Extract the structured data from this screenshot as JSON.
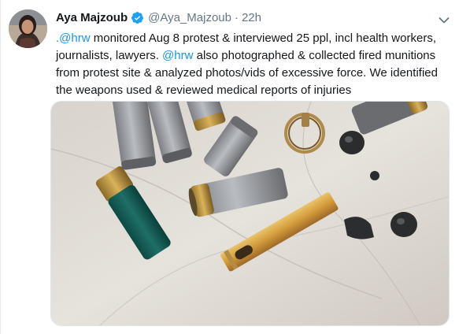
{
  "tweet": {
    "author_name": "Aya Majzoub",
    "handle": "@Aya_Majzoub",
    "separator": "·",
    "time": "22h",
    "text_lines": [
      {
        "mention": ".@hrw",
        "rest": " monitored Aug 8 protest & interviewed 25 ppl, incl health workers,"
      },
      {
        "before": "journalists, lawyers. ",
        "mention": "@hrw",
        "after": " also photographed & collected fired munitions"
      },
      {
        "text": "from protest site & analyzed photos/vids of excessive force. We identified"
      },
      {
        "text": "the weapons used & reviewed medical reports of injuries"
      }
    ]
  },
  "icons": {
    "verified": "verified-badge-icon",
    "caret": "chevron-down-icon"
  },
  "colors": {
    "link": "#1b95e0",
    "verified": "#1da1f2",
    "secondary_text": "#657786",
    "primary_text": "#14171a"
  }
}
